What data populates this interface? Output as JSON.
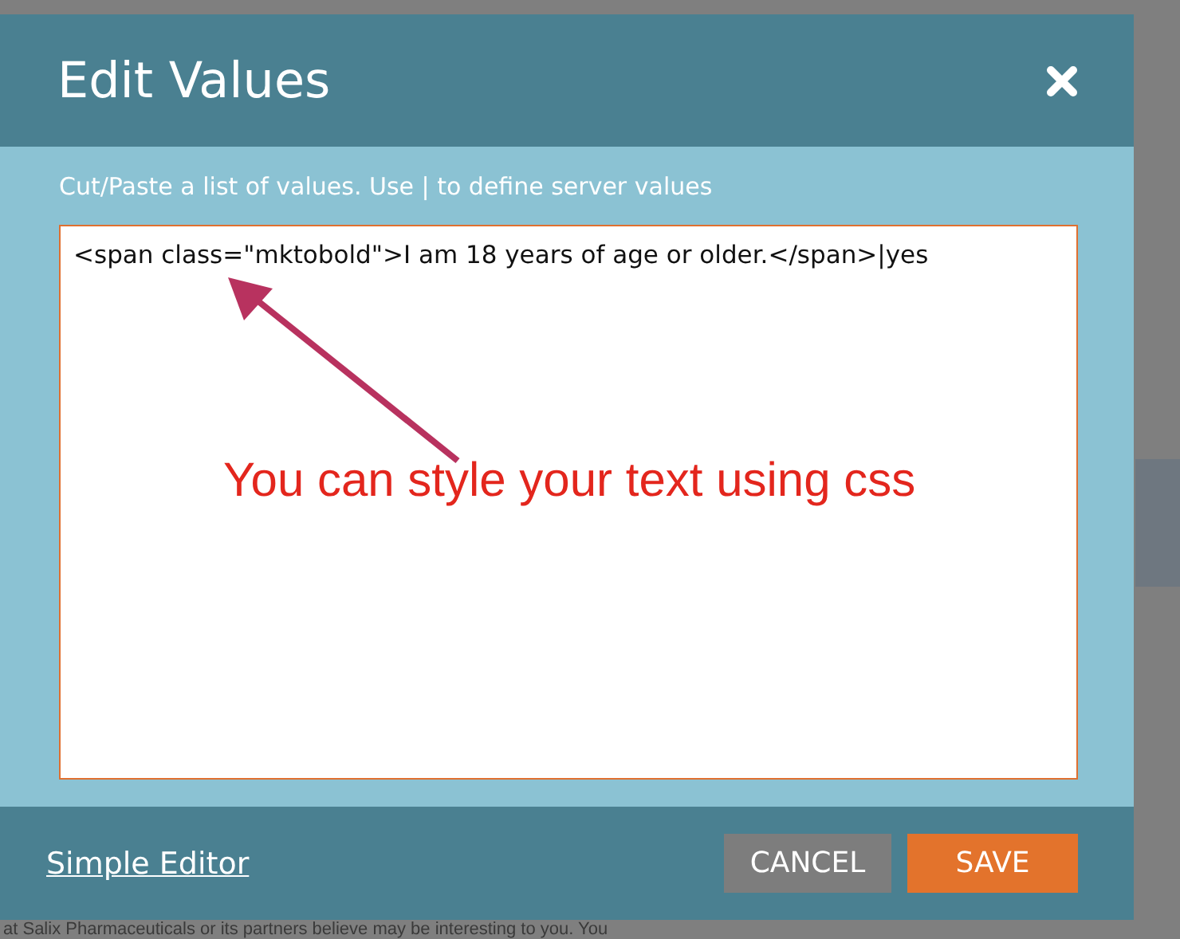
{
  "dialog": {
    "title": "Edit Values",
    "instruction": "Cut/Paste a list of values. Use | to define server values",
    "value": "<span class=\"mktobold\">I am 18 years of age or older.</span>|yes",
    "annotation": "You can style your text using css",
    "footer_link": "Simple Editor",
    "buttons": [
      {
        "label": "CANCEL",
        "kind": "secondary"
      },
      {
        "label": "SAVE",
        "kind": "primary"
      }
    ]
  },
  "background_text": "at Salix Pharmaceuticals or its partners believe may be interesting to you. You"
}
